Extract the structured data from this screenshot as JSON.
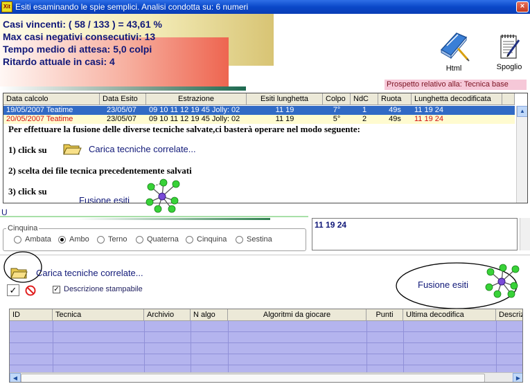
{
  "window": {
    "title": "Esiti esaminando le spie semplici. Analisi condotta su: 6 numeri",
    "app_icon": "Xit",
    "close": "×"
  },
  "stats": {
    "line1": "Casi vincenti: ( 58 / 133 ) = 43,61 %",
    "line2": "Max casi negativi consecutivi: 13",
    "line3": "Tempo medio di attesa: 5,0 colpi",
    "line4": "Ritardo attuale in casi: 4"
  },
  "toolbar": {
    "html_label": "Html",
    "spoglio_label": "Spoglio"
  },
  "prospetto": "Prospetto relativo alla: Tecnica base",
  "grid": {
    "columns": [
      "Data calcolo",
      "Data Esito",
      "Estrazione",
      "Esiti lunghetta",
      "Colpo",
      "NdC",
      "Ruota",
      "Lunghetta decodificata"
    ],
    "rows": [
      [
        "19/05/2007 Teatime",
        "23/05/07",
        "09 10 11 12 19 45 Jolly: 02",
        "11 19",
        "7°",
        "1",
        "49s",
        "11 19 24"
      ],
      [
        "20/05/2007 Teatime",
        "23/05/07",
        "09 10 11 12 19 45 Jolly: 02",
        "11 19",
        "5°",
        "2",
        "49s",
        "11 19 24"
      ]
    ]
  },
  "overlay": {
    "intro": "Per effettuare la fusione delle diverse tecniche salvate,ci basterà operare nel modo seguente:",
    "step1": "1) click su",
    "step1_link": "Carica tecniche correlate...",
    "step2": "2) scelta dei file tecnica precedentemente salvati",
    "step3": "3) click su",
    "step3_link": "Fusione esiti"
  },
  "partial_label": "U",
  "cinquina": {
    "legend": "Cinquina",
    "options": [
      "Ambata",
      "Ambo",
      "Terno",
      "Quaterna",
      "Cinquina",
      "Sestina"
    ],
    "selected": "Ambo"
  },
  "result_box": "11 19 24",
  "carica": {
    "label": "Carica tecniche correlate..."
  },
  "descrizione": {
    "label": "Descrizione stampabile",
    "checked": true
  },
  "fusione": {
    "label": "Fusione esiti"
  },
  "grid2": {
    "columns": [
      "ID",
      "Tecnica",
      "Archivio",
      "N algo",
      "Algoritmi da giocare",
      "Punti",
      "Ultima decodifica",
      "Descriz"
    ]
  },
  "colors": {
    "title_bar": "#0a48c8",
    "stats_text": "#101878",
    "selected_row": "#316ac5",
    "grid2_bg": "#b4b4ee"
  },
  "icons": [
    "html-book-icon",
    "spoglio-notepad-icon",
    "folder-open-icon",
    "molecule-icon",
    "check-icon",
    "no-entry-icon"
  ]
}
